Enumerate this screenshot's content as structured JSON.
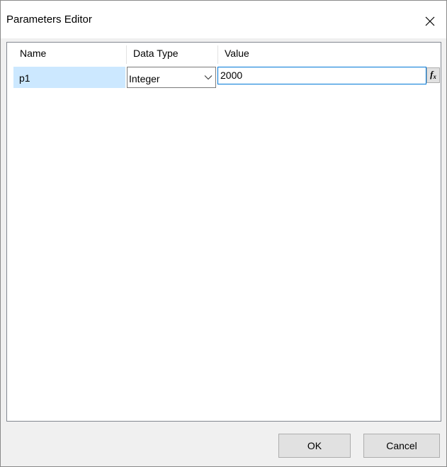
{
  "window": {
    "title": "Parameters Editor",
    "close_icon": "close-icon"
  },
  "grid": {
    "columns": [
      "Name",
      "Data Type",
      "Value"
    ],
    "rows": [
      {
        "name": "p1",
        "data_type": "Integer",
        "value": "2000",
        "expression_button_label": "fx"
      }
    ]
  },
  "buttons": {
    "ok": "OK",
    "cancel": "Cancel"
  },
  "colors": {
    "selection": "#cce8ff",
    "focus_border": "#0078d7",
    "dialog_background": "#f0f0f0"
  }
}
